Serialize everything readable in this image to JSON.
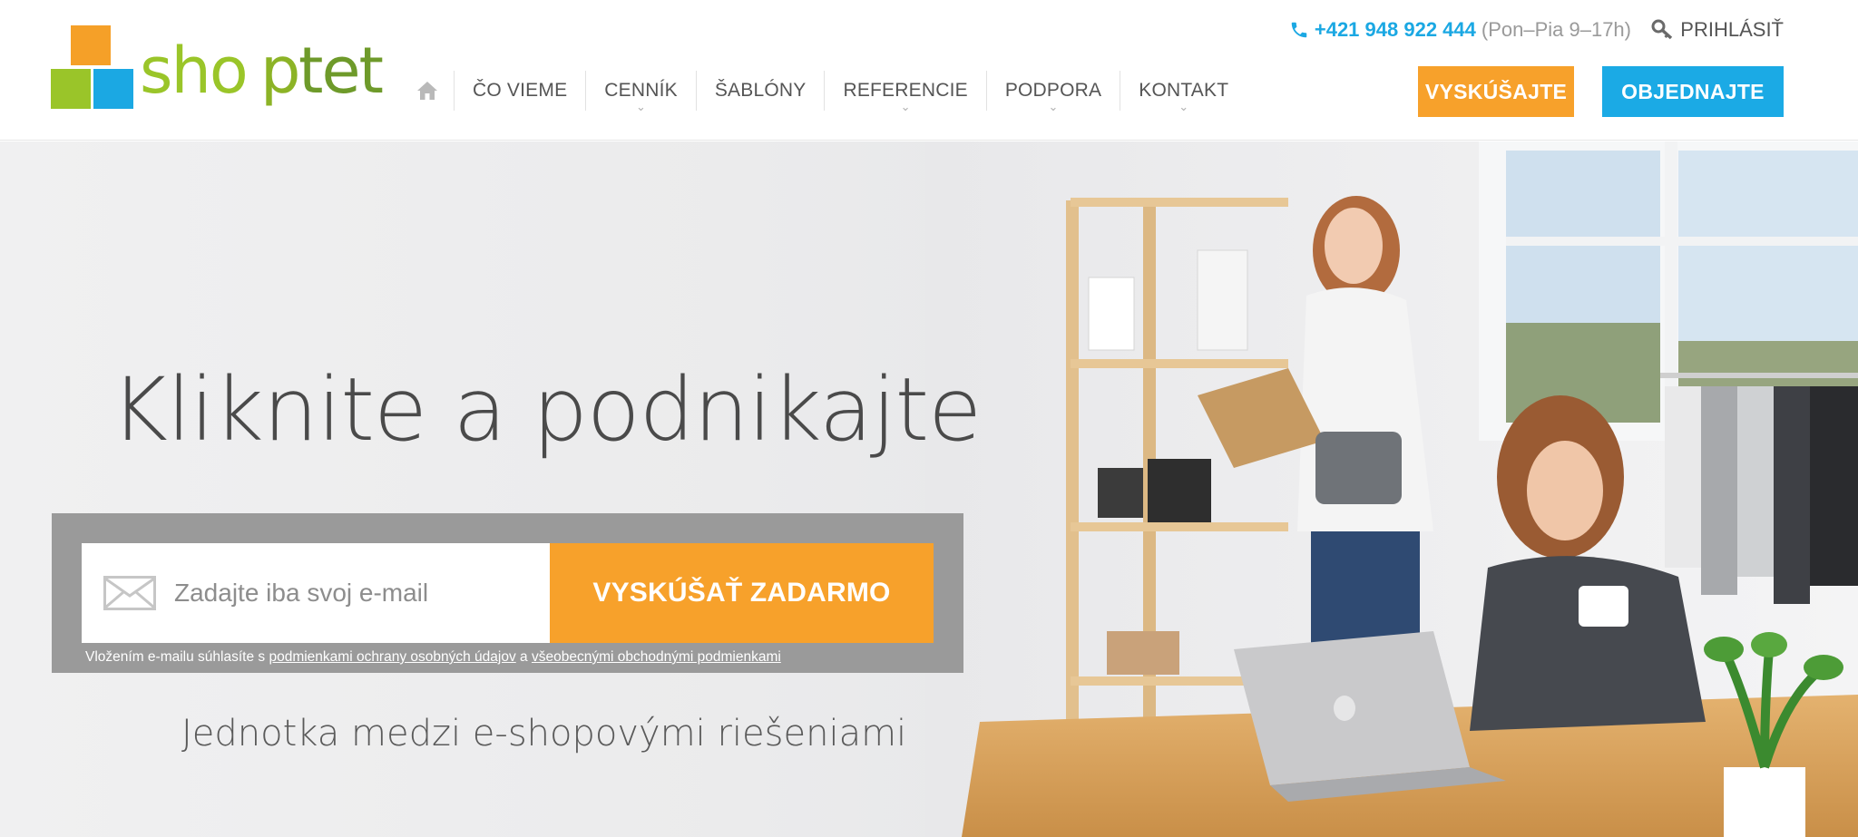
{
  "brand": {
    "name": "shoptet",
    "colors": {
      "orange": "#f5a028",
      "green": "#9ac529",
      "blue": "#1ba8e3"
    }
  },
  "nav": {
    "home_icon": "home-icon",
    "items": [
      {
        "label": "ČO VIEME",
        "dropdown": false
      },
      {
        "label": "CENNÍK",
        "dropdown": true
      },
      {
        "label": "ŠABLÓNY",
        "dropdown": false
      },
      {
        "label": "REFERENCIE",
        "dropdown": true
      },
      {
        "label": "PODPORA",
        "dropdown": true
      },
      {
        "label": "KONTAKT",
        "dropdown": true
      }
    ]
  },
  "contact": {
    "phone_icon": "phone-icon",
    "phone": "+421 948 922 444",
    "hours": "(Pon–Pia 9–17h)"
  },
  "login": {
    "icon": "key-icon",
    "label": "PRIHLÁSIŤ"
  },
  "header_buttons": {
    "try": "VYSKÚŠAJTE",
    "order": "OBJEDNAJTE"
  },
  "hero": {
    "headline": "Kliknite a podnikajte",
    "email_placeholder": "Zadajte iba svoj e-mail",
    "cta": "VYSKÚŠAŤ ZADARMO",
    "terms_prefix": "Vložením e-mailu súhlasíte s ",
    "terms_link1": "podmienkami ochrany osobných údajov",
    "terms_mid": " a ",
    "terms_link2": "všeobecnými obchodnými podmienkami",
    "subheadline": "Jednotka medzi e-shopovými riešeniami"
  }
}
